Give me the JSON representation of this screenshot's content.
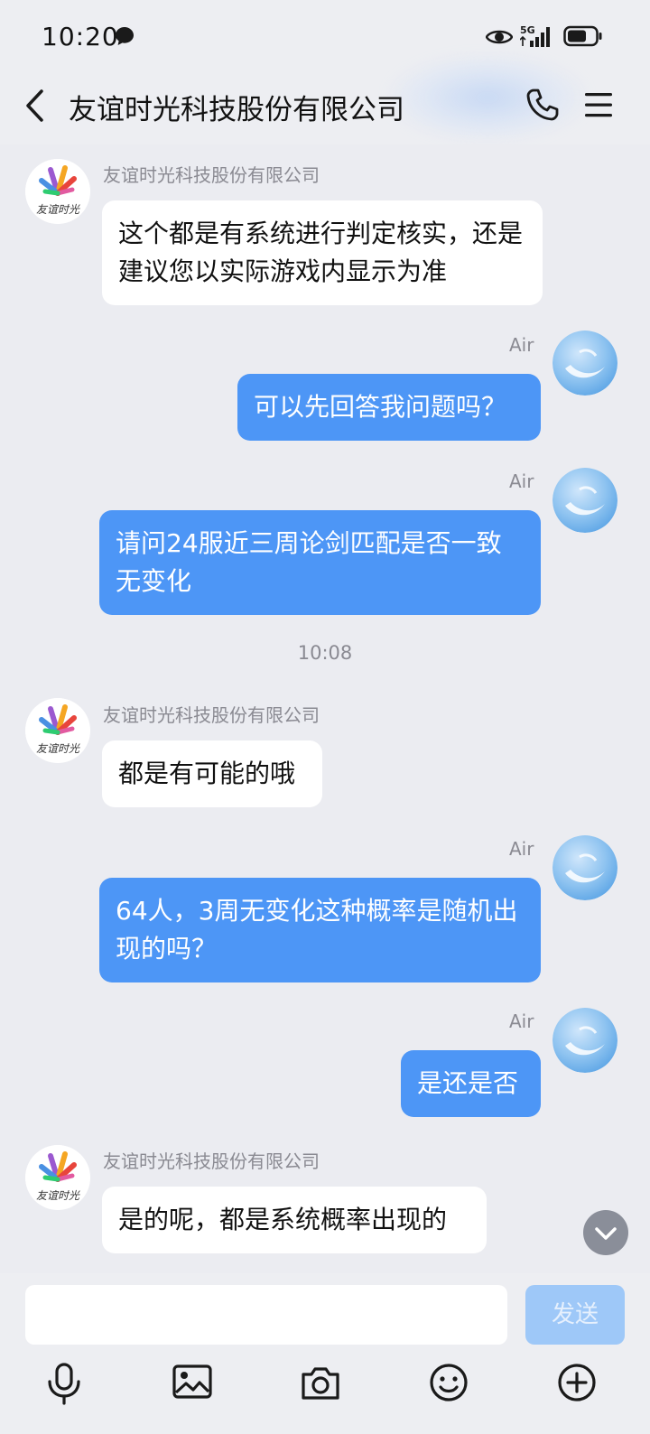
{
  "status_bar": {
    "time": "10:20",
    "network": "5G"
  },
  "header": {
    "title": "友谊时光科技股份有限公司"
  },
  "colors": {
    "outgoing_bubble": "#4d96f6",
    "incoming_bubble": "#ffffff",
    "background": "#ebecf1",
    "send_button_disabled": "#9ec8f8"
  },
  "messages": [
    {
      "sender": "友谊时光科技股份有限公司",
      "direction": "in",
      "text": "这个都是有系统进行判定核实，还是建议您以实际游戏内显示为准"
    },
    {
      "sender": "Air",
      "direction": "out",
      "text": "可以先回答我问题吗？"
    },
    {
      "sender": "Air",
      "direction": "out",
      "text": "请问24服近三周论剑匹配是否一致无变化"
    },
    {
      "separator": "10:08"
    },
    {
      "sender": "友谊时光科技股份有限公司",
      "direction": "in",
      "text": "都是有可能的哦"
    },
    {
      "sender": "Air",
      "direction": "out",
      "text": "64人，3周无变化这种概率是随机出现的吗？"
    },
    {
      "sender": "Air",
      "direction": "out",
      "text": "是还是否"
    },
    {
      "sender": "友谊时光科技股份有限公司",
      "direction": "in",
      "text": "是的呢，都是系统概率出现的"
    }
  ],
  "company_logo_text": "友谊时光",
  "input": {
    "value": "",
    "placeholder": ""
  },
  "send_label": "发送",
  "toolbar": [
    "microphone-icon",
    "image-icon",
    "camera-icon",
    "emoji-icon",
    "plus-icon"
  ]
}
